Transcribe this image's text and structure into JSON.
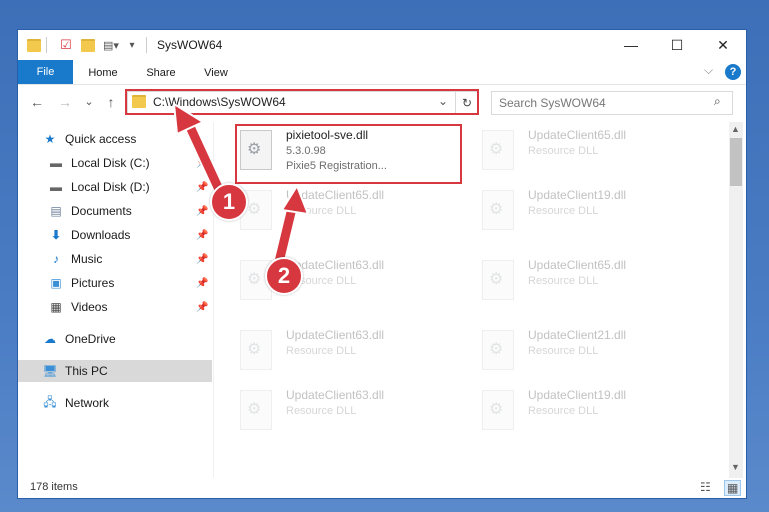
{
  "window": {
    "title": "SysWOW64"
  },
  "window_controls": {
    "minimize": "—",
    "maximize": "☐",
    "close": "✕"
  },
  "ribbon": {
    "tabs": [
      "File",
      "Home",
      "Share",
      "View"
    ],
    "help": "?",
    "expand": "⌵"
  },
  "nav": {
    "back": "←",
    "forward": "→",
    "recent": "⌄",
    "up": "↑",
    "address": "C:\\Windows\\SysWOW64",
    "address_dropdown": "⌄",
    "refresh": "↻",
    "search_placeholder": "Search SysWOW64",
    "search_icon": "search-icon"
  },
  "sidebar": {
    "items": [
      {
        "label": "Quick access",
        "icon": "star-icon"
      },
      {
        "label": "Local Disk (C:)",
        "icon": "drive-icon",
        "pinned": true
      },
      {
        "label": "Local Disk (D:)",
        "icon": "drive-icon",
        "pinned": true
      },
      {
        "label": "Documents",
        "icon": "documents-icon",
        "pinned": true
      },
      {
        "label": "Downloads",
        "icon": "download-icon",
        "pinned": true
      },
      {
        "label": "Music",
        "icon": "music-icon",
        "pinned": true
      },
      {
        "label": "Pictures",
        "icon": "pictures-icon",
        "pinned": true
      },
      {
        "label": "Videos",
        "icon": "video-icon",
        "pinned": true
      },
      {
        "label": "OneDrive",
        "icon": "cloud-icon"
      },
      {
        "label": "This PC",
        "icon": "computer-icon",
        "selected": true
      },
      {
        "label": "Network",
        "icon": "network-icon"
      }
    ]
  },
  "files": [
    {
      "name": "pixietool-sve.dll",
      "version": "5.3.0.98",
      "description": "Pixie5 Registration..."
    },
    {
      "name": "UpdateClient65.dll",
      "description": "Resource DLL"
    },
    {
      "name": "UpdateClient65.dll",
      "description": "Resource DLL"
    },
    {
      "name": "UpdateClient19.dll",
      "description": "Resource DLL"
    },
    {
      "name": "UpdateClient63.dll",
      "description": "Resource DLL"
    },
    {
      "name": "UpdateClient65.dll",
      "description": "Resource DLL"
    },
    {
      "name": "UpdateClient63.dll",
      "description": "Resource DLL"
    },
    {
      "name": "UpdateClient21.dll",
      "description": "Resource DLL"
    },
    {
      "name": "UpdateClient63.dll",
      "description": "Resource DLL"
    },
    {
      "name": "UpdateClient19.dll",
      "description": "Resource DLL"
    }
  ],
  "status": {
    "count": "178 items"
  },
  "annotations": {
    "step1": "1",
    "step2": "2",
    "color": "#d7373f"
  }
}
